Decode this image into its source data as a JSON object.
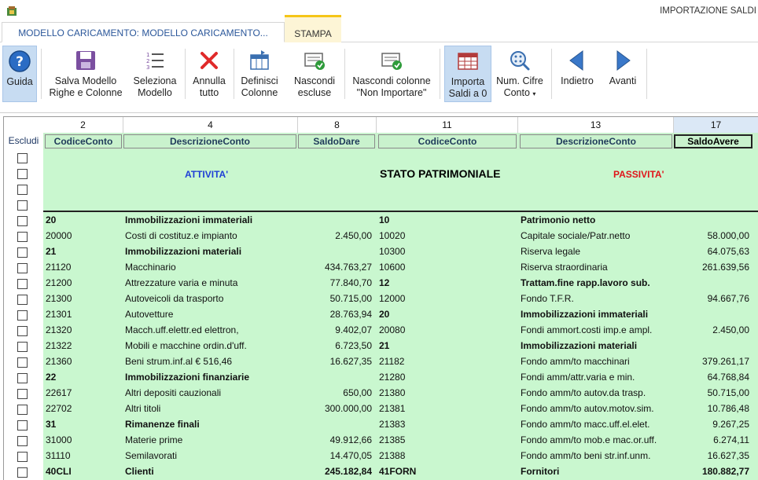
{
  "window": {
    "title": "IMPORTAZIONE SALDI"
  },
  "tabs": [
    {
      "label": "MODELLO CARICAMENTO: MODELLO CARICAMENTO..."
    },
    {
      "label": "STAMPA"
    }
  ],
  "toolbar": {
    "guida": "Guida",
    "salva": [
      "Salva Modello",
      "Righe e Colonne"
    ],
    "seleziona": [
      "Seleziona",
      "Modello"
    ],
    "annulla": [
      "Annulla",
      "tutto"
    ],
    "definisci": [
      "Definisci",
      "Colonne"
    ],
    "nascondi_escluse": [
      "Nascondi",
      "escluse"
    ],
    "nascondi_colonne": [
      "Nascondi colonne",
      "\"Non Importare\""
    ],
    "importa": [
      "Importa",
      "Saldi a 0"
    ],
    "num_cifre": [
      "Num. Cifre",
      "Conto"
    ],
    "indietro": "Indietro",
    "avanti": "Avanti"
  },
  "grid": {
    "escludi_label": "Escludi",
    "col_numbers": [
      "2",
      "4",
      "8",
      "11",
      "13",
      "17"
    ],
    "headers": [
      "CodiceConto",
      "DescrizioneConto",
      "SaldoDare",
      "CodiceConto",
      "DescrizioneConto",
      "SaldoAvere"
    ],
    "title_attivita": "ATTIVITA'",
    "title_stato": "STATO PATRIMONIALE",
    "title_passivita": "PASSIVITA'",
    "rows": [
      {
        "bold": true,
        "c1": "20",
        "d1": "Immobilizzazioni immateriali",
        "s1": "",
        "c2": "10",
        "d2": "Patrimonio netto",
        "s2": "",
        "b2": true
      },
      {
        "bold": false,
        "c1": "20000",
        "d1": "Costi di costituz.e impianto",
        "s1": "2.450,00",
        "c2": "10020",
        "d2": "Capitale sociale/Patr.netto",
        "s2": "58.000,00",
        "b2": false
      },
      {
        "bold": true,
        "c1": "21",
        "d1": "Immobilizzazioni materiali",
        "s1": "",
        "c2": "10300",
        "d2": "Riserva legale",
        "s2": "64.075,63",
        "b2": false
      },
      {
        "bold": false,
        "c1": "21120",
        "d1": "Macchinario",
        "s1": "434.763,27",
        "c2": "10600",
        "d2": "Riserva straordinaria",
        "s2": "261.639,56",
        "b2": false
      },
      {
        "bold": false,
        "c1": "21200",
        "d1": "Attrezzature varia e minuta",
        "s1": "77.840,70",
        "c2": "12",
        "d2": "Trattam.fine rapp.lavoro sub.",
        "s2": "",
        "b2": true
      },
      {
        "bold": false,
        "c1": "21300",
        "d1": "Autoveicoli da trasporto",
        "s1": "50.715,00",
        "c2": "12000",
        "d2": "Fondo T.F.R.",
        "s2": "94.667,76",
        "b2": false
      },
      {
        "bold": false,
        "c1": "21301",
        "d1": "Autovetture",
        "s1": "28.763,94",
        "c2": "20",
        "d2": "Immobilizzazioni immateriali",
        "s2": "",
        "b2": true
      },
      {
        "bold": false,
        "c1": "21320",
        "d1": "Macch.uff.elettr.ed elettron,",
        "s1": "9.402,07",
        "c2": "20080",
        "d2": "Fondi ammort.costi imp.e ampl.",
        "s2": "2.450,00",
        "b2": false
      },
      {
        "bold": false,
        "c1": "21322",
        "d1": "Mobili e macchine ordin.d'uff.",
        "s1": "6.723,50",
        "c2": "21",
        "d2": "Immobilizzazioni materiali",
        "s2": "",
        "b2": true
      },
      {
        "bold": false,
        "c1": "21360",
        "d1": "Beni strum.inf.al € 516,46",
        "s1": "16.627,35",
        "c2": "21182",
        "d2": "Fondo amm/to macchinari",
        "s2": "379.261,17",
        "b2": false
      },
      {
        "bold": true,
        "c1": "22",
        "d1": "Immobilizzazioni finanziarie",
        "s1": "",
        "c2": "21280",
        "d2": "Fondi amm/attr.varia e min.",
        "s2": "64.768,84",
        "b2": false
      },
      {
        "bold": false,
        "c1": "22617",
        "d1": "Altri depositi cauzionali",
        "s1": "650,00",
        "c2": "21380",
        "d2": "Fondo amm/to autov.da trasp.",
        "s2": "50.715,00",
        "b2": false
      },
      {
        "bold": false,
        "c1": "22702",
        "d1": "Altri titoli",
        "s1": "300.000,00",
        "c2": "21381",
        "d2": "Fondo amm/to autov.motov.sim.",
        "s2": "10.786,48",
        "b2": false
      },
      {
        "bold": true,
        "c1": "31",
        "d1": "Rimanenze finali",
        "s1": "",
        "c2": "21383",
        "d2": "Fondo amm/to macc.uff.el.elet.",
        "s2": "9.267,25",
        "b2": false
      },
      {
        "bold": false,
        "c1": "31000",
        "d1": "Materie prime",
        "s1": "49.912,66",
        "c2": "21385",
        "d2": "Fondo amm/to mob.e mac.or.uff.",
        "s2": "6.274,11",
        "b2": false
      },
      {
        "bold": false,
        "c1": "31110",
        "d1": "Semilavorati",
        "s1": "14.470,05",
        "c2": "21388",
        "d2": "Fondo amm/to beni str.inf.unm.",
        "s2": "16.627,35",
        "b2": false
      },
      {
        "bold": true,
        "c1": "40CLI",
        "d1": "Clienti",
        "s1": "245.182,84",
        "c2": "41FORN",
        "d2": "Fornitori",
        "s2": "180.882,77",
        "b2": true
      }
    ]
  }
}
